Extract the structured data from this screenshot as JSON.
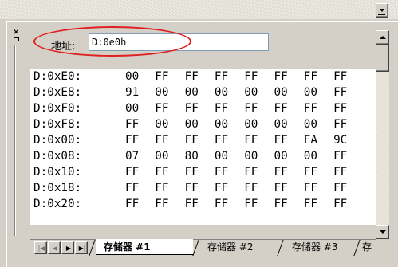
{
  "address": {
    "label": "地址:",
    "value": "D:0e0h"
  },
  "memory_rows": [
    {
      "addr": "D:0xE0:",
      "bytes": [
        "00",
        "FF",
        "FF",
        "FF",
        "FF",
        "FF",
        "FF",
        "FF"
      ]
    },
    {
      "addr": "D:0xE8:",
      "bytes": [
        "91",
        "00",
        "00",
        "00",
        "00",
        "00",
        "00",
        "FF"
      ]
    },
    {
      "addr": "D:0xF0:",
      "bytes": [
        "00",
        "FF",
        "FF",
        "FF",
        "FF",
        "FF",
        "FF",
        "FF"
      ]
    },
    {
      "addr": "D:0xF8:",
      "bytes": [
        "FF",
        "00",
        "00",
        "00",
        "00",
        "00",
        "00",
        "FF"
      ]
    },
    {
      "addr": "D:0x00:",
      "bytes": [
        "FF",
        "FF",
        "FF",
        "FF",
        "FF",
        "FF",
        "FA",
        "9C"
      ]
    },
    {
      "addr": "D:0x08:",
      "bytes": [
        "07",
        "00",
        "80",
        "00",
        "00",
        "00",
        "00",
        "FF"
      ]
    },
    {
      "addr": "D:0x10:",
      "bytes": [
        "FF",
        "FF",
        "FF",
        "FF",
        "FF",
        "FF",
        "FF",
        "FF"
      ]
    },
    {
      "addr": "D:0x18:",
      "bytes": [
        "FF",
        "FF",
        "FF",
        "FF",
        "FF",
        "FF",
        "FF",
        "FF"
      ]
    },
    {
      "addr": "D:0x20:",
      "bytes": [
        "FF",
        "FF",
        "FF",
        "FF",
        "FF",
        "FF",
        "FF",
        "FF"
      ]
    }
  ],
  "tabs": [
    {
      "label": "存储器 #1",
      "active": true
    },
    {
      "label": "存储器 #2",
      "active": false
    },
    {
      "label": "存储器 #3",
      "active": false
    },
    {
      "label": "存",
      "active": false
    }
  ],
  "icons": {
    "close": "close-icon",
    "pin": "pin-icon",
    "nav_first": "first-icon",
    "nav_prev": "prev-icon",
    "nav_next": "next-icon",
    "nav_last": "last-icon"
  },
  "colors": {
    "highlight_circle": "#e02020",
    "panel": "#d4d0c8",
    "grid_bg": "#ffffff"
  }
}
